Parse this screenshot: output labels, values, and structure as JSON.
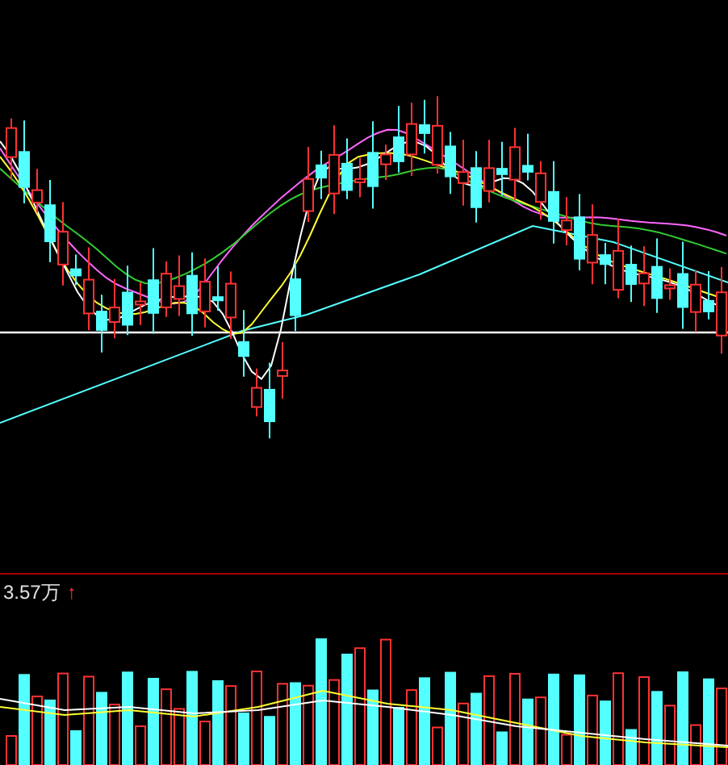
{
  "volume_panel": {
    "value": "3.57万",
    "arrow": "↑"
  }
}
